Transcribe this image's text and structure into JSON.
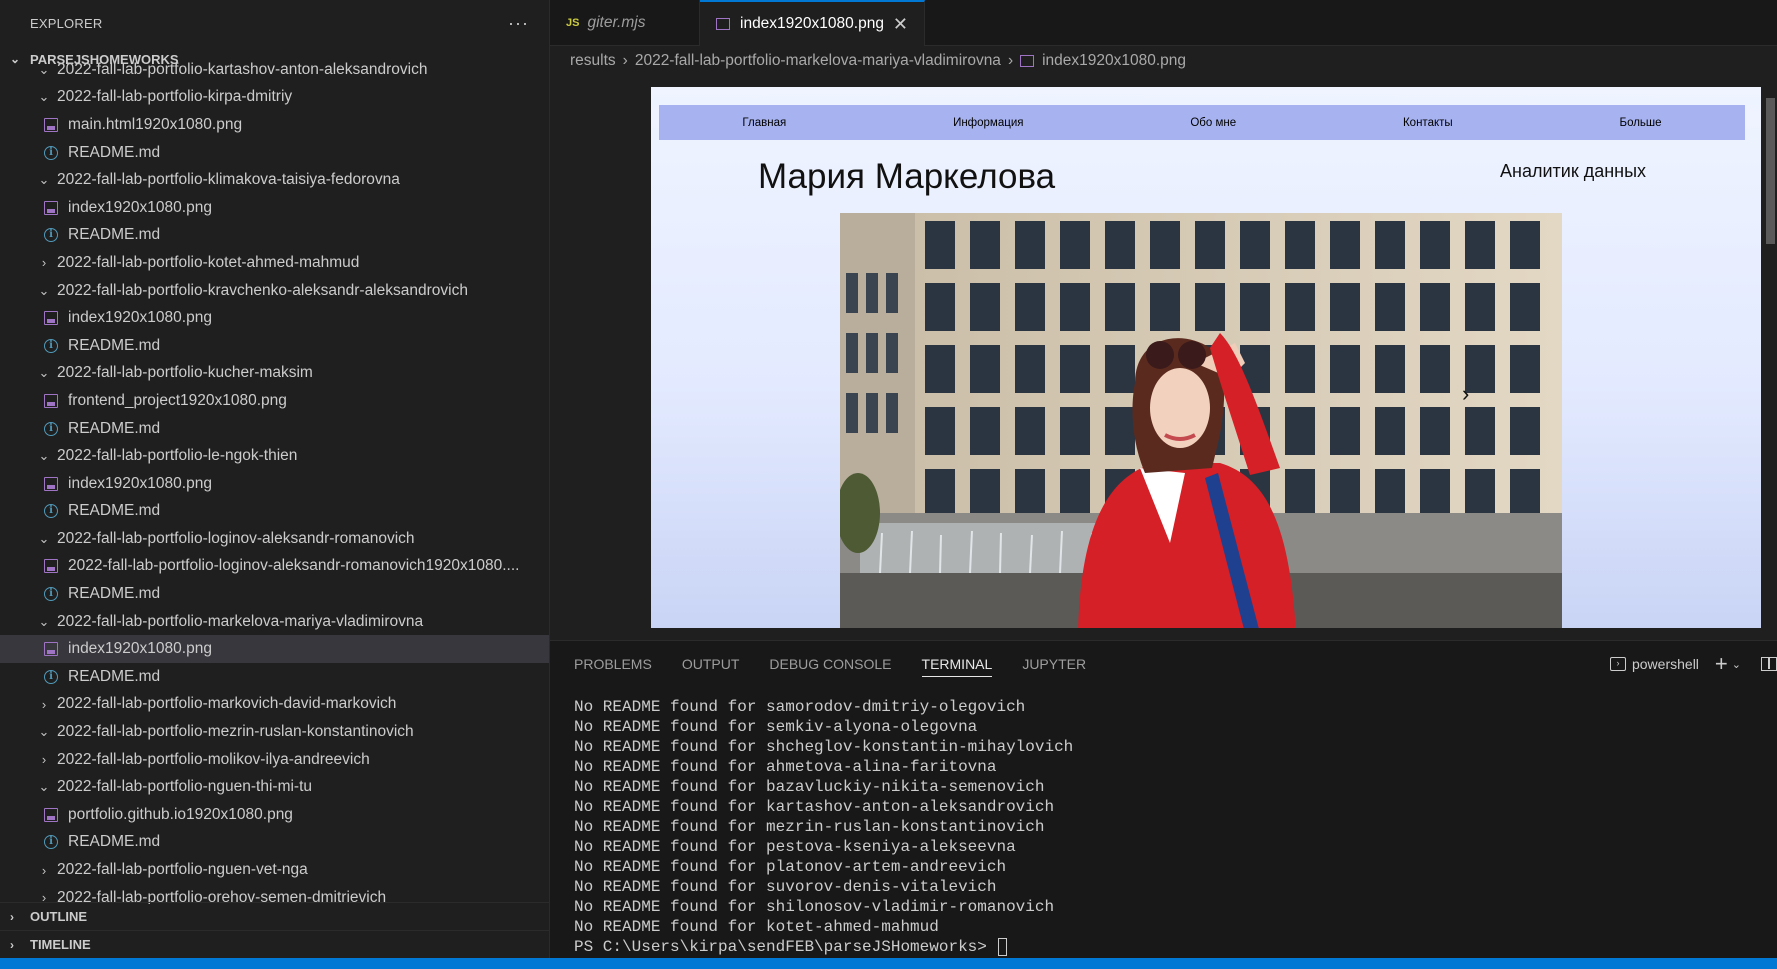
{
  "sidebar": {
    "title": "EXPLORER",
    "more": "···",
    "workspace": "PARSEJSHOMEWORKS",
    "tree": [
      {
        "type": "folder",
        "open": true,
        "label": "2022-fall-lab-portfolio-kartashov-anton-aleksandrovich"
      },
      {
        "type": "folder",
        "open": true,
        "label": "2022-fall-lab-portfolio-kirpa-dmitriy"
      },
      {
        "type": "png",
        "label": "main.html1920x1080.png"
      },
      {
        "type": "info",
        "label": "README.md"
      },
      {
        "type": "folder",
        "open": true,
        "label": "2022-fall-lab-portfolio-klimakova-taisiya-fedorovna"
      },
      {
        "type": "png",
        "label": "index1920x1080.png"
      },
      {
        "type": "info",
        "label": "README.md"
      },
      {
        "type": "folder",
        "open": false,
        "label": "2022-fall-lab-portfolio-kotet-ahmed-mahmud"
      },
      {
        "type": "folder",
        "open": true,
        "label": "2022-fall-lab-portfolio-kravchenko-aleksandr-aleksandrovich"
      },
      {
        "type": "png",
        "label": "index1920x1080.png"
      },
      {
        "type": "info",
        "label": "README.md"
      },
      {
        "type": "folder",
        "open": true,
        "label": "2022-fall-lab-portfolio-kucher-maksim"
      },
      {
        "type": "png",
        "label": "frontend_project1920x1080.png"
      },
      {
        "type": "info",
        "label": "README.md"
      },
      {
        "type": "folder",
        "open": true,
        "label": "2022-fall-lab-portfolio-le-ngok-thien"
      },
      {
        "type": "png",
        "label": "index1920x1080.png"
      },
      {
        "type": "info",
        "label": "README.md"
      },
      {
        "type": "folder",
        "open": true,
        "label": "2022-fall-lab-portfolio-loginov-aleksandr-romanovich"
      },
      {
        "type": "png",
        "label": "2022-fall-lab-portfolio-loginov-aleksandr-romanovich1920x1080...."
      },
      {
        "type": "info",
        "label": "README.md"
      },
      {
        "type": "folder",
        "open": true,
        "label": "2022-fall-lab-portfolio-markelova-mariya-vladimirovna"
      },
      {
        "type": "png",
        "label": "index1920x1080.png",
        "selected": true
      },
      {
        "type": "info",
        "label": "README.md"
      },
      {
        "type": "folder",
        "open": false,
        "label": "2022-fall-lab-portfolio-markovich-david-markovich"
      },
      {
        "type": "folder",
        "open": true,
        "label": "2022-fall-lab-portfolio-mezrin-ruslan-konstantinovich"
      },
      {
        "type": "folder",
        "open": false,
        "label": "2022-fall-lab-portfolio-molikov-ilya-andreevich"
      },
      {
        "type": "folder",
        "open": true,
        "label": "2022-fall-lab-portfolio-nguen-thi-mi-tu"
      },
      {
        "type": "png",
        "label": "portfolio.github.io1920x1080.png"
      },
      {
        "type": "info",
        "label": "README.md"
      },
      {
        "type": "folder",
        "open": false,
        "label": "2022-fall-lab-portfolio-nguen-vet-nga"
      },
      {
        "type": "folder",
        "open": false,
        "label": "2022-fall-lab-portfolio-orehov-semen-dmitrievich"
      }
    ],
    "outline": "OUTLINE",
    "timeline": "TIMELINE"
  },
  "tabs": [
    {
      "label": "giter.mjs",
      "icon": "JS",
      "active": false
    },
    {
      "label": "index1920x1080.png",
      "active": true,
      "close": "✕"
    }
  ],
  "breadcrumb": {
    "parts": [
      "results",
      "2022-fall-lab-portfolio-markelova-mariya-vladimirovna",
      "index1920x1080.png"
    ]
  },
  "preview": {
    "nav": [
      "Главная",
      "Информация",
      "Обо мне",
      "Контакты",
      "Больше"
    ],
    "name": "Мария Маркелова",
    "role": "Аналитик данных",
    "arrow_next": "›"
  },
  "panel": {
    "tabs": [
      "PROBLEMS",
      "OUTPUT",
      "DEBUG CONSOLE",
      "TERMINAL",
      "JUPYTER"
    ],
    "active_tab": "TERMINAL",
    "shell": "powershell",
    "terminal_lines": [
      "No README found for samorodov-dmitriy-olegovich",
      "No README found for semkiv-alyona-olegovna",
      "No README found for shcheglov-konstantin-mihaylovich",
      "No README found for ahmetova-alina-faritovna",
      "No README found for bazavluckiy-nikita-semenovich",
      "No README found for kartashov-anton-aleksandrovich",
      "No README found for mezrin-ruslan-konstantinovich",
      "No README found for pestova-kseniya-alekseevna",
      "No README found for platonov-artem-andreevich",
      "No README found for suvorov-denis-vitalevich",
      "No README found for shilonosov-vladimir-romanovich",
      "No README found for kotet-ahmed-mahmud"
    ],
    "prompt": "PS C:\\Users\\kirpa\\sendFEB\\parseJSHomeworks> "
  },
  "colors": {
    "accent": "#0078d4",
    "nav_bar": "#a7b3f1",
    "coat": "#d42026"
  }
}
